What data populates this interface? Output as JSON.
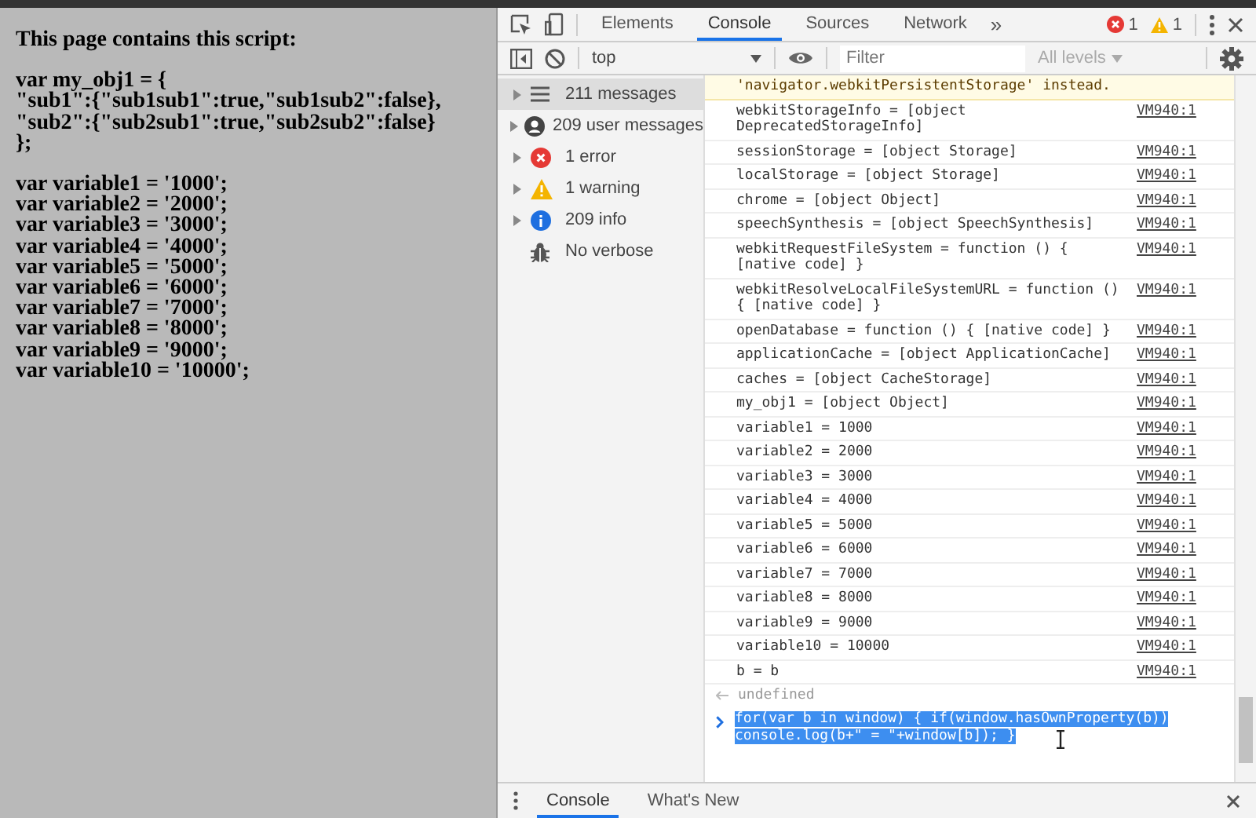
{
  "page": {
    "heading": "This page contains this script:",
    "blocks": [
      [
        "var my_obj1 = {",
        "\"sub1\":{\"sub1sub1\":true,\"sub1sub2\":false},",
        "\"sub2\":{\"sub2sub1\":true,\"sub2sub2\":false}",
        "};"
      ],
      [
        "var variable1 = '1000';",
        "var variable2 = '2000';",
        "var variable3 = '3000';",
        "var variable4 = '4000';",
        "var variable5 = '5000';",
        "var variable6 = '6000';",
        "var variable7 = '7000';",
        "var variable8 = '8000';",
        "var variable9 = '9000';",
        "var variable10 = '10000';"
      ]
    ]
  },
  "devtools": {
    "tabs": [
      {
        "label": "Elements",
        "selected": false
      },
      {
        "label": "Console",
        "selected": true
      },
      {
        "label": "Sources",
        "selected": false
      },
      {
        "label": "Network",
        "selected": false
      }
    ],
    "more_tabs": "»",
    "error_count": "1",
    "warning_count": "1",
    "console_toolbar": {
      "context": "top",
      "filter_placeholder": "Filter",
      "levels": "All levels"
    },
    "sidebar": [
      {
        "kind": "messages",
        "label": "211 messages",
        "selected": true
      },
      {
        "kind": "user",
        "label": "209 user messages",
        "selected": false
      },
      {
        "kind": "error",
        "label": "1 error",
        "selected": false
      },
      {
        "kind": "warning",
        "label": "1 warning",
        "selected": false
      },
      {
        "kind": "info",
        "label": "209 info",
        "selected": false
      },
      {
        "kind": "verbose",
        "label": "No verbose",
        "selected": false
      }
    ],
    "messages": [
      {
        "kind": "warning",
        "text": "'navigator.webkitPersistentStorage' instead."
      },
      {
        "kind": "log",
        "text": "webkitStorageInfo = [object DeprecatedStorageInfo]",
        "source": "VM940:1"
      },
      {
        "kind": "log",
        "text": "sessionStorage = [object Storage]",
        "source": "VM940:1"
      },
      {
        "kind": "log",
        "text": "localStorage = [object Storage]",
        "source": "VM940:1"
      },
      {
        "kind": "log",
        "text": "chrome = [object Object]",
        "source": "VM940:1"
      },
      {
        "kind": "log",
        "text": "speechSynthesis = [object SpeechSynthesis]",
        "source": "VM940:1"
      },
      {
        "kind": "log",
        "text": "webkitRequestFileSystem = function () { [native code] }",
        "source": "VM940:1"
      },
      {
        "kind": "log",
        "text": "webkitResolveLocalFileSystemURL = function () { [native code] }",
        "source": "VM940:1"
      },
      {
        "kind": "log",
        "text": "openDatabase = function () { [native code] }",
        "source": "VM940:1"
      },
      {
        "kind": "log",
        "text": "applicationCache = [object ApplicationCache]",
        "source": "VM940:1"
      },
      {
        "kind": "log",
        "text": "caches = [object CacheStorage]",
        "source": "VM940:1"
      },
      {
        "kind": "log",
        "text": "my_obj1 = [object Object]",
        "source": "VM940:1"
      },
      {
        "kind": "log",
        "text": "variable1 = 1000",
        "source": "VM940:1"
      },
      {
        "kind": "log",
        "text": "variable2 = 2000",
        "source": "VM940:1"
      },
      {
        "kind": "log",
        "text": "variable3 = 3000",
        "source": "VM940:1"
      },
      {
        "kind": "log",
        "text": "variable4 = 4000",
        "source": "VM940:1"
      },
      {
        "kind": "log",
        "text": "variable5 = 5000",
        "source": "VM940:1"
      },
      {
        "kind": "log",
        "text": "variable6 = 6000",
        "source": "VM940:1"
      },
      {
        "kind": "log",
        "text": "variable7 = 7000",
        "source": "VM940:1"
      },
      {
        "kind": "log",
        "text": "variable8 = 8000",
        "source": "VM940:1"
      },
      {
        "kind": "log",
        "text": "variable9 = 9000",
        "source": "VM940:1"
      },
      {
        "kind": "log",
        "text": "variable10 = 10000",
        "source": "VM940:1"
      },
      {
        "kind": "log",
        "text": "b = b",
        "source": "VM940:1"
      },
      {
        "kind": "result",
        "text": "undefined"
      }
    ],
    "input": "for(var b in window) { if(window.hasOwnProperty(b)) console.log(b+\" = \"+window[b]); }",
    "drawer_tabs": [
      {
        "label": "Console",
        "selected": true
      },
      {
        "label": "What's New",
        "selected": false
      }
    ]
  }
}
